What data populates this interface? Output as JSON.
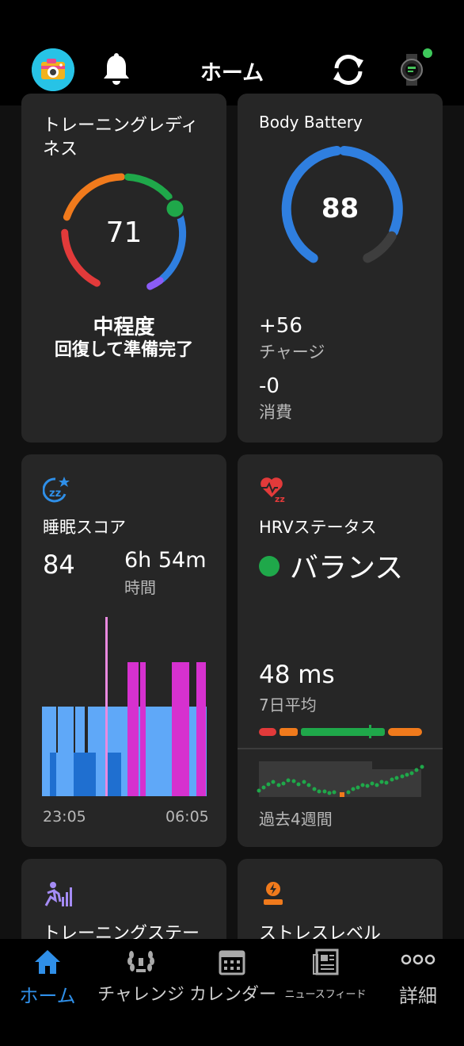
{
  "header": {
    "title": "ホーム",
    "avatar_icon": "camera-avatar-icon",
    "notification_icon": "bell-icon",
    "sync_icon": "sync-icon",
    "device_icon": "watch-icon",
    "device_status_color": "#3ec95b"
  },
  "training_readiness": {
    "title_line1": "トレーニングレディ",
    "title_line2": "ネス",
    "score": "71",
    "level": "中程度",
    "description": "回復して準備完了"
  },
  "body_battery": {
    "title": "Body Battery",
    "value": "88",
    "level_fraction": 0.88,
    "charged_value": "+56",
    "charged_label": "チャージ",
    "drained_value": "-0",
    "drained_label": "消費"
  },
  "sleep": {
    "icon": "sleep-zz-icon",
    "title": "睡眠スコア",
    "score": "84",
    "duration": "6h 54m",
    "duration_label": "時間",
    "start_time": "23:05",
    "end_time": "06:05"
  },
  "hrv": {
    "icon": "hrv-heart-icon",
    "title": "HRVステータス",
    "status": "バランス",
    "status_color": "#1fa84a",
    "value": "48 ms",
    "value_label": "7日平均",
    "trend_label": "過去4週間"
  },
  "training_status": {
    "icon": "training-status-icon",
    "title": "トレーニングステー"
  },
  "stress": {
    "icon": "stress-icon",
    "title": "ストレスレベル"
  },
  "nav": {
    "home": "ホーム",
    "challenges": "チャレンジ",
    "calendar": "カレンダー",
    "newsfeed": "ニュースフィード",
    "more": "詳細",
    "active_color": "#2f8fe8"
  }
}
